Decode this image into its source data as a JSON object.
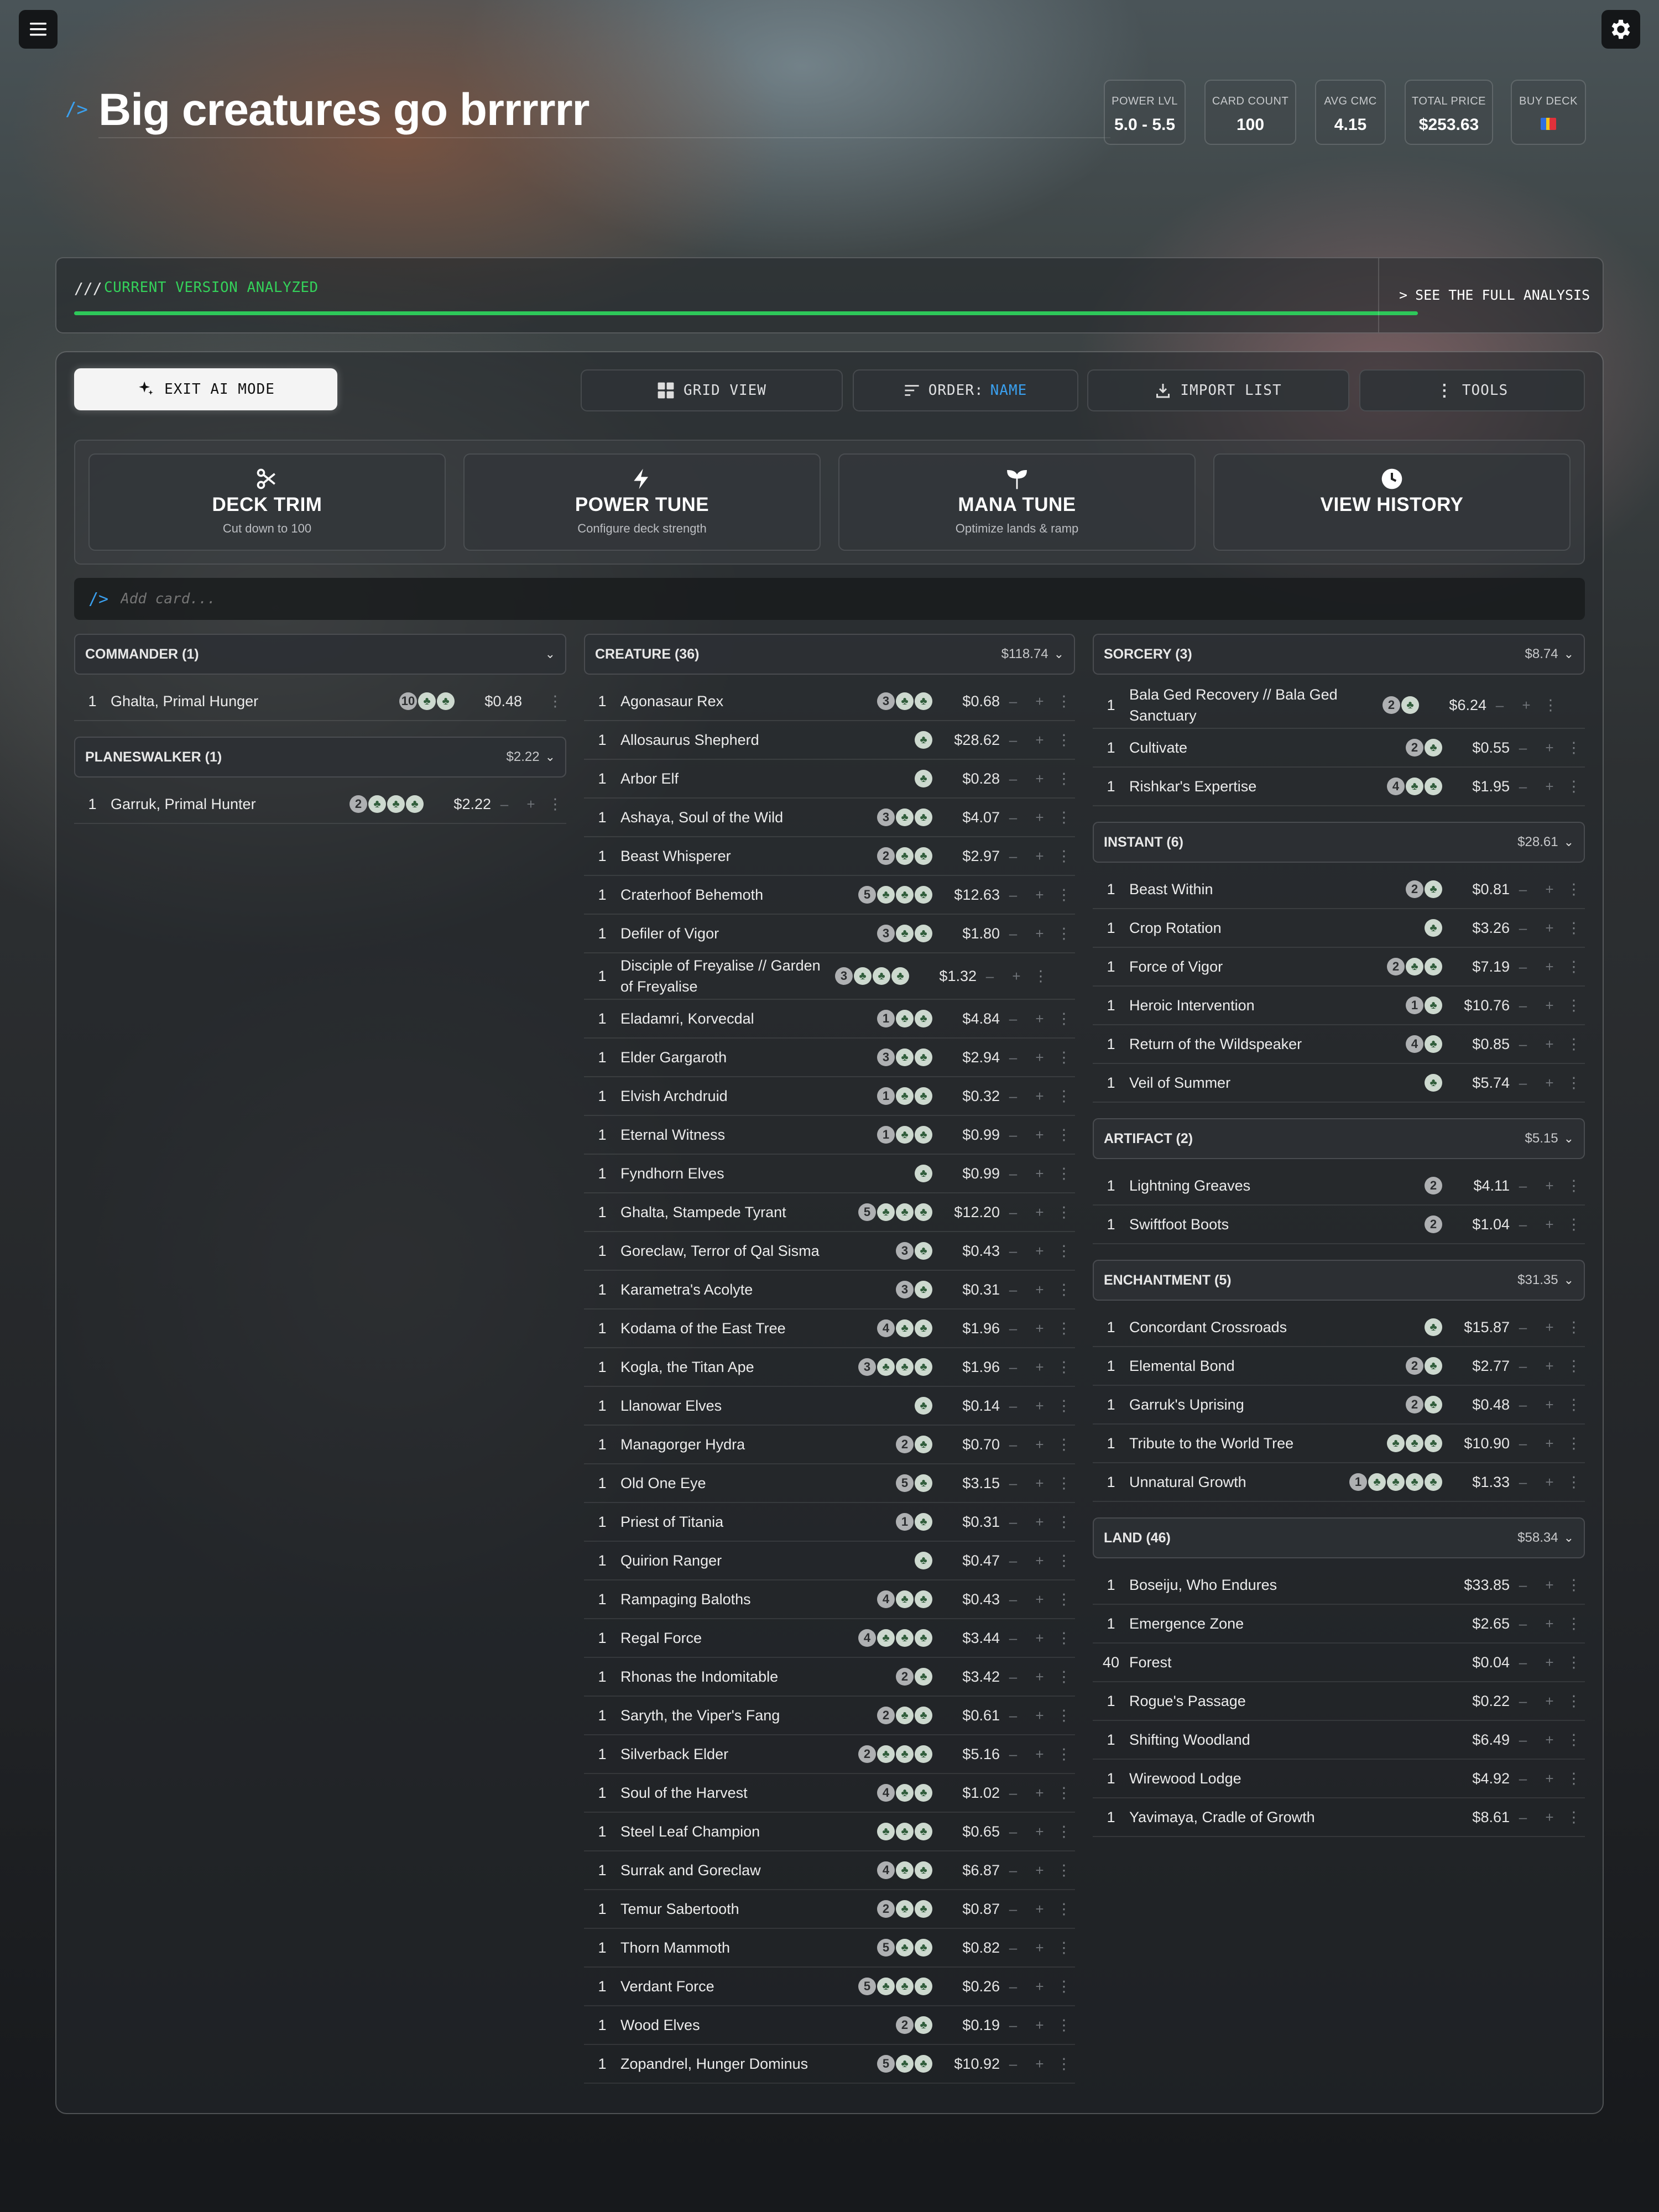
{
  "deck": {
    "title": "Big creatures go brrrrrr",
    "prompt": "/>"
  },
  "stats": [
    {
      "label": "POWER LVL",
      "value": "5.0 - 5.5"
    },
    {
      "label": "CARD COUNT",
      "value": "100"
    },
    {
      "label": "AVG CMC",
      "value": "4.15"
    },
    {
      "label": "TOTAL PRICE",
      "value": "$253.63"
    },
    {
      "label": "BUY DECK",
      "value": ""
    }
  ],
  "analysis": {
    "prefix": "///",
    "status": "CURRENT VERSION ANALYZED",
    "progress": 1.0,
    "link_prefix": ">",
    "link_label": "SEE THE FULL ANALYSIS",
    "status_color": "#34d15a"
  },
  "toolbar": {
    "exit_ai": "EXIT AI MODE",
    "grid_view": "GRID VIEW",
    "order_label": "ORDER:",
    "order_value": "NAME",
    "import": "IMPORT LIST",
    "tools": "TOOLS"
  },
  "tools": [
    {
      "title": "DECK TRIM",
      "subtitle": "Cut down to 100",
      "icon": "scissors-icon"
    },
    {
      "title": "POWER TUNE",
      "subtitle": "Configure deck strength",
      "icon": "lightning-icon"
    },
    {
      "title": "MANA TUNE",
      "subtitle": "Optimize lands & ramp",
      "icon": "sprout-icon"
    },
    {
      "title": "VIEW HISTORY",
      "subtitle": "",
      "icon": "clock-icon"
    }
  ],
  "add_card": {
    "prompt": "/>",
    "placeholder": "Add card..."
  },
  "columns": [
    [
      {
        "title": "COMMANDER (1)",
        "price": "",
        "cards": [
          {
            "qty": "1",
            "name": "Ghalta, Primal Hunger",
            "cost": [
              "10",
              "G",
              "G"
            ],
            "price": "$0.48",
            "commander": true
          }
        ]
      },
      {
        "title": "PLANESWALKER (1)",
        "price": "$2.22",
        "cards": [
          {
            "qty": "1",
            "name": "Garruk, Primal Hunter",
            "cost": [
              "2",
              "G",
              "G",
              "G"
            ],
            "price": "$2.22"
          }
        ]
      }
    ],
    [
      {
        "title": "CREATURE (36)",
        "price": "$118.74",
        "cards": [
          {
            "qty": "1",
            "name": "Agonasaur Rex",
            "cost": [
              "3",
              "G",
              "G"
            ],
            "price": "$0.68"
          },
          {
            "qty": "1",
            "name": "Allosaurus Shepherd",
            "cost": [
              "G"
            ],
            "price": "$28.62"
          },
          {
            "qty": "1",
            "name": "Arbor Elf",
            "cost": [
              "G"
            ],
            "price": "$0.28"
          },
          {
            "qty": "1",
            "name": "Ashaya, Soul of the Wild",
            "cost": [
              "3",
              "G",
              "G"
            ],
            "price": "$4.07"
          },
          {
            "qty": "1",
            "name": "Beast Whisperer",
            "cost": [
              "2",
              "G",
              "G"
            ],
            "price": "$2.97"
          },
          {
            "qty": "1",
            "name": "Craterhoof Behemoth",
            "cost": [
              "5",
              "G",
              "G",
              "G"
            ],
            "price": "$12.63"
          },
          {
            "qty": "1",
            "name": "Defiler of Vigor",
            "cost": [
              "3",
              "G",
              "G"
            ],
            "price": "$1.80"
          },
          {
            "qty": "1",
            "name": "Disciple of Freyalise // Garden of Freyalise",
            "cost": [
              "3",
              "G",
              "G",
              "G"
            ],
            "price": "$1.32"
          },
          {
            "qty": "1",
            "name": "Eladamri, Korvecdal",
            "cost": [
              "1",
              "G",
              "G"
            ],
            "price": "$4.84"
          },
          {
            "qty": "1",
            "name": "Elder Gargaroth",
            "cost": [
              "3",
              "G",
              "G"
            ],
            "price": "$2.94"
          },
          {
            "qty": "1",
            "name": "Elvish Archdruid",
            "cost": [
              "1",
              "G",
              "G"
            ],
            "price": "$0.32"
          },
          {
            "qty": "1",
            "name": "Eternal Witness",
            "cost": [
              "1",
              "G",
              "G"
            ],
            "price": "$0.99"
          },
          {
            "qty": "1",
            "name": "Fyndhorn Elves",
            "cost": [
              "G"
            ],
            "price": "$0.99"
          },
          {
            "qty": "1",
            "name": "Ghalta, Stampede Tyrant",
            "cost": [
              "5",
              "G",
              "G",
              "G"
            ],
            "price": "$12.20"
          },
          {
            "qty": "1",
            "name": "Goreclaw, Terror of Qal Sisma",
            "cost": [
              "3",
              "G"
            ],
            "price": "$0.43"
          },
          {
            "qty": "1",
            "name": "Karametra's Acolyte",
            "cost": [
              "3",
              "G"
            ],
            "price": "$0.31"
          },
          {
            "qty": "1",
            "name": "Kodama of the East Tree",
            "cost": [
              "4",
              "G",
              "G"
            ],
            "price": "$1.96"
          },
          {
            "qty": "1",
            "name": "Kogla, the Titan Ape",
            "cost": [
              "3",
              "G",
              "G",
              "G"
            ],
            "price": "$1.96"
          },
          {
            "qty": "1",
            "name": "Llanowar Elves",
            "cost": [
              "G"
            ],
            "price": "$0.14"
          },
          {
            "qty": "1",
            "name": "Managorger Hydra",
            "cost": [
              "2",
              "G"
            ],
            "price": "$0.70"
          },
          {
            "qty": "1",
            "name": "Old One Eye",
            "cost": [
              "5",
              "G"
            ],
            "price": "$3.15"
          },
          {
            "qty": "1",
            "name": "Priest of Titania",
            "cost": [
              "1",
              "G"
            ],
            "price": "$0.31"
          },
          {
            "qty": "1",
            "name": "Quirion Ranger",
            "cost": [
              "G"
            ],
            "price": "$0.47"
          },
          {
            "qty": "1",
            "name": "Rampaging Baloths",
            "cost": [
              "4",
              "G",
              "G"
            ],
            "price": "$0.43"
          },
          {
            "qty": "1",
            "name": "Regal Force",
            "cost": [
              "4",
              "G",
              "G",
              "G"
            ],
            "price": "$3.44"
          },
          {
            "qty": "1",
            "name": "Rhonas the Indomitable",
            "cost": [
              "2",
              "G"
            ],
            "price": "$3.42"
          },
          {
            "qty": "1",
            "name": "Saryth, the Viper's Fang",
            "cost": [
              "2",
              "G",
              "G"
            ],
            "price": "$0.61"
          },
          {
            "qty": "1",
            "name": "Silverback Elder",
            "cost": [
              "2",
              "G",
              "G",
              "G"
            ],
            "price": "$5.16"
          },
          {
            "qty": "1",
            "name": "Soul of the Harvest",
            "cost": [
              "4",
              "G",
              "G"
            ],
            "price": "$1.02"
          },
          {
            "qty": "1",
            "name": "Steel Leaf Champion",
            "cost": [
              "G",
              "G",
              "G"
            ],
            "price": "$0.65"
          },
          {
            "qty": "1",
            "name": "Surrak and Goreclaw",
            "cost": [
              "4",
              "G",
              "G"
            ],
            "price": "$6.87"
          },
          {
            "qty": "1",
            "name": "Temur Sabertooth",
            "cost": [
              "2",
              "G",
              "G"
            ],
            "price": "$0.87"
          },
          {
            "qty": "1",
            "name": "Thorn Mammoth",
            "cost": [
              "5",
              "G",
              "G"
            ],
            "price": "$0.82"
          },
          {
            "qty": "1",
            "name": "Verdant Force",
            "cost": [
              "5",
              "G",
              "G",
              "G"
            ],
            "price": "$0.26"
          },
          {
            "qty": "1",
            "name": "Wood Elves",
            "cost": [
              "2",
              "G"
            ],
            "price": "$0.19"
          },
          {
            "qty": "1",
            "name": "Zopandrel, Hunger Dominus",
            "cost": [
              "5",
              "G",
              "G"
            ],
            "price": "$10.92"
          }
        ]
      }
    ],
    [
      {
        "title": "SORCERY (3)",
        "price": "$8.74",
        "cards": [
          {
            "qty": "1",
            "name": "Bala Ged Recovery // Bala Ged Sanctuary",
            "cost": [
              "2",
              "G"
            ],
            "price": "$6.24"
          },
          {
            "qty": "1",
            "name": "Cultivate",
            "cost": [
              "2",
              "G"
            ],
            "price": "$0.55"
          },
          {
            "qty": "1",
            "name": "Rishkar's Expertise",
            "cost": [
              "4",
              "G",
              "G"
            ],
            "price": "$1.95"
          }
        ]
      },
      {
        "title": "INSTANT (6)",
        "price": "$28.61",
        "cards": [
          {
            "qty": "1",
            "name": "Beast Within",
            "cost": [
              "2",
              "G"
            ],
            "price": "$0.81"
          },
          {
            "qty": "1",
            "name": "Crop Rotation",
            "cost": [
              "G"
            ],
            "price": "$3.26"
          },
          {
            "qty": "1",
            "name": "Force of Vigor",
            "cost": [
              "2",
              "G",
              "G"
            ],
            "price": "$7.19"
          },
          {
            "qty": "1",
            "name": "Heroic Intervention",
            "cost": [
              "1",
              "G"
            ],
            "price": "$10.76"
          },
          {
            "qty": "1",
            "name": "Return of the Wildspeaker",
            "cost": [
              "4",
              "G"
            ],
            "price": "$0.85"
          },
          {
            "qty": "1",
            "name": "Veil of Summer",
            "cost": [
              "G"
            ],
            "price": "$5.74"
          }
        ]
      },
      {
        "title": "ARTIFACT (2)",
        "price": "$5.15",
        "cards": [
          {
            "qty": "1",
            "name": "Lightning Greaves",
            "cost": [
              "2"
            ],
            "price": "$4.11"
          },
          {
            "qty": "1",
            "name": "Swiftfoot Boots",
            "cost": [
              "2"
            ],
            "price": "$1.04"
          }
        ]
      },
      {
        "title": "ENCHANTMENT (5)",
        "price": "$31.35",
        "cards": [
          {
            "qty": "1",
            "name": "Concordant Crossroads",
            "cost": [
              "G"
            ],
            "price": "$15.87"
          },
          {
            "qty": "1",
            "name": "Elemental Bond",
            "cost": [
              "2",
              "G"
            ],
            "price": "$2.77"
          },
          {
            "qty": "1",
            "name": "Garruk's Uprising",
            "cost": [
              "2",
              "G"
            ],
            "price": "$0.48"
          },
          {
            "qty": "1",
            "name": "Tribute to the World Tree",
            "cost": [
              "G",
              "G",
              "G"
            ],
            "price": "$10.90"
          },
          {
            "qty": "1",
            "name": "Unnatural Growth",
            "cost": [
              "1",
              "G",
              "G",
              "G",
              "G"
            ],
            "price": "$1.33"
          }
        ]
      },
      {
        "title": "LAND (46)",
        "price": "$58.34",
        "cards": [
          {
            "qty": "1",
            "name": "Boseiju, Who Endures",
            "cost": [],
            "price": "$33.85"
          },
          {
            "qty": "1",
            "name": "Emergence Zone",
            "cost": [],
            "price": "$2.65"
          },
          {
            "qty": "40",
            "name": "Forest",
            "cost": [],
            "price": "$0.04"
          },
          {
            "qty": "1",
            "name": "Rogue's Passage",
            "cost": [],
            "price": "$0.22"
          },
          {
            "qty": "1",
            "name": "Shifting Woodland",
            "cost": [],
            "price": "$6.49"
          },
          {
            "qty": "1",
            "name": "Wirewood Lodge",
            "cost": [],
            "price": "$4.92"
          },
          {
            "qty": "1",
            "name": "Yavimaya, Cradle of Growth",
            "cost": [],
            "price": "$8.61"
          }
        ]
      }
    ]
  ],
  "colors": {
    "accent": "#3aa0ef",
    "green": "#34d15a",
    "background": "#17191c"
  }
}
